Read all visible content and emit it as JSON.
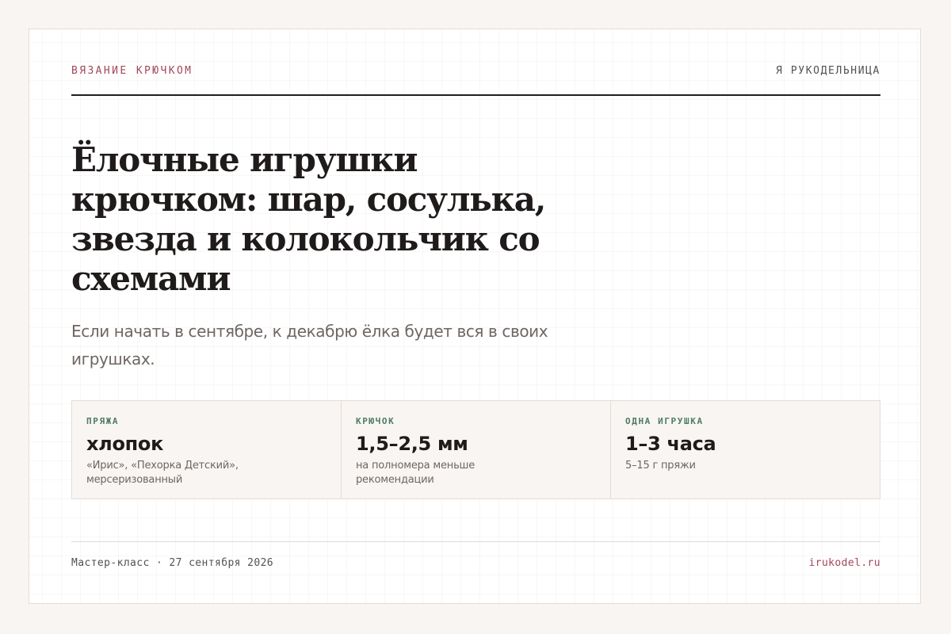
{
  "header": {
    "kicker": "ВЯЗАНИЕ КРЮЧКОМ",
    "site_name": "Я РУКОДЕЛЬНИЦА"
  },
  "article": {
    "title": "Ёлочные игрушки крючком: шар, сосулька, звезда и колокольчик со схемами",
    "lead": "Если начать в сентябре, к декабрю ёлка будет вся в своих игрушках."
  },
  "facts": [
    {
      "label": "ПРЯЖА",
      "value": "хлопок",
      "note": "«Ирис», «Пехорка Детский», мерсеризованный"
    },
    {
      "label": "КРЮЧОК",
      "value": "1,5–2,5 мм",
      "note": "на полномера меньше рекомендации"
    },
    {
      "label": "ОДНА ИГРУШКА",
      "value": "1–3 часа",
      "note": "5–15 г пряжи"
    }
  ],
  "footer": {
    "date_line": "Мастер-класс · 27 сентября 2026",
    "site_link": "irukodel.ru"
  },
  "colors": {
    "accent": "#a3465a",
    "label_green": "#4f7b65",
    "text_dark": "#1e1b1a",
    "text_muted": "#6e6662",
    "page_bg": "#f8f5f2"
  }
}
